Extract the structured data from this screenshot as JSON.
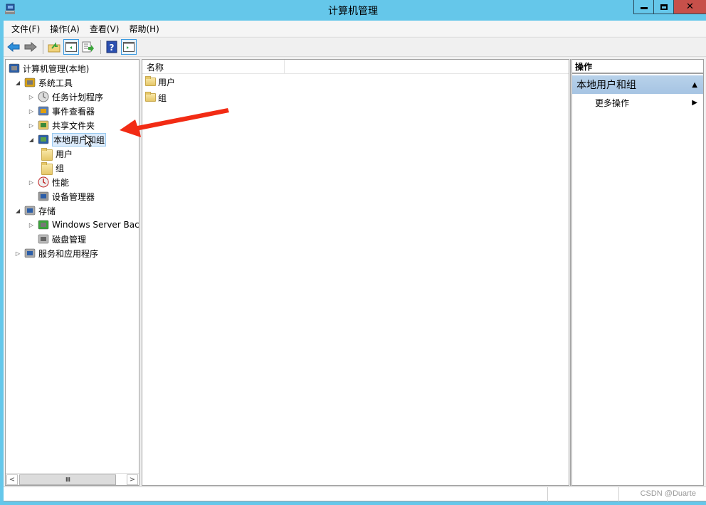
{
  "window": {
    "title": "计算机管理",
    "controls": {
      "minimize": "minimize",
      "maximize": "maximize",
      "close": "x"
    }
  },
  "menubar": [
    "文件(F)",
    "操作(A)",
    "查看(V)",
    "帮助(H)"
  ],
  "toolbar": {
    "buttons": [
      "back-icon",
      "forward-icon",
      "up-folder-icon",
      "show-hide-tree-icon",
      "export-list-icon",
      "help-icon",
      "show-hide-action-pane-icon"
    ]
  },
  "tree": {
    "items": [
      {
        "label": "计算机管理(本地)",
        "level": 0,
        "expander": "",
        "icon": "computer-management-icon"
      },
      {
        "label": "系统工具",
        "level": 1,
        "expander": "expanded",
        "icon": "tools-icon"
      },
      {
        "label": "任务计划程序",
        "level": 2,
        "expander": "collapsed",
        "icon": "clock-icon"
      },
      {
        "label": "事件查看器",
        "level": 2,
        "expander": "collapsed",
        "icon": "event-viewer-icon"
      },
      {
        "label": "共享文件夹",
        "level": 2,
        "expander": "collapsed",
        "icon": "shared-folder-icon"
      },
      {
        "label": "本地用户和组",
        "level": 2,
        "expander": "expanded",
        "icon": "users-group-icon",
        "selected": true
      },
      {
        "label": "用户",
        "level": 3,
        "expander": "",
        "icon": "folder-icon"
      },
      {
        "label": "组",
        "level": 3,
        "expander": "",
        "icon": "folder-icon"
      },
      {
        "label": "性能",
        "level": 2,
        "expander": "collapsed",
        "icon": "performance-icon"
      },
      {
        "label": "设备管理器",
        "level": 2,
        "expander": "",
        "icon": "device-manager-icon"
      },
      {
        "label": "存储",
        "level": 1,
        "expander": "expanded",
        "icon": "storage-icon"
      },
      {
        "label": "Windows Server Back",
        "level": 2,
        "expander": "collapsed",
        "icon": "backup-icon"
      },
      {
        "label": "磁盘管理",
        "level": 2,
        "expander": "",
        "icon": "disk-icon"
      },
      {
        "label": "服务和应用程序",
        "level": 1,
        "expander": "collapsed",
        "icon": "services-icon"
      }
    ],
    "scrollbar": {
      "left": "<",
      "right": ">",
      "grip": "III"
    }
  },
  "list": {
    "column_header": "名称",
    "rows": [
      "用户",
      "组"
    ]
  },
  "actions": {
    "header": "操作",
    "group_title": "本地用户和组",
    "group_caret": "▲",
    "items": [
      {
        "label": "更多操作",
        "caret": "▶"
      }
    ]
  },
  "statusbar": {
    "watermark": "CSDN @Duarte"
  },
  "annotation": {
    "arrow_color": "#f22b14"
  }
}
